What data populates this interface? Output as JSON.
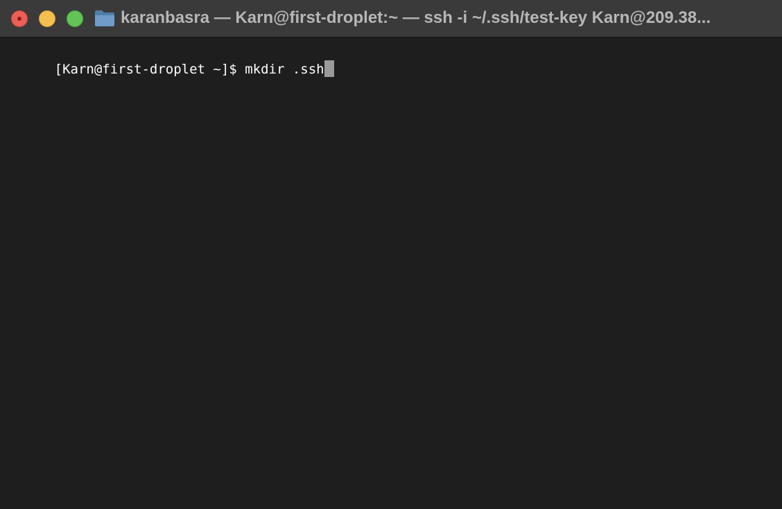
{
  "window": {
    "title": "karanbasra — Karn@first-droplet:~ — ssh -i ~/.ssh/test-key Karn@209.38..."
  },
  "icons": {
    "close": "close-button",
    "minimize": "minimize-button",
    "maximize": "maximize-button",
    "folder": "folder-icon"
  },
  "colors": {
    "close": "#ec5f57",
    "minimize": "#f5bf4f",
    "maximize": "#61c454",
    "terminal_bg": "#1e1e1e",
    "titlebar_bg": "#3a3a3a",
    "text": "#ffffff",
    "cursor": "#9a9a9a"
  },
  "terminal": {
    "prompt": "[Karn@first-droplet ~]$ ",
    "command": "mkdir .ssh"
  }
}
